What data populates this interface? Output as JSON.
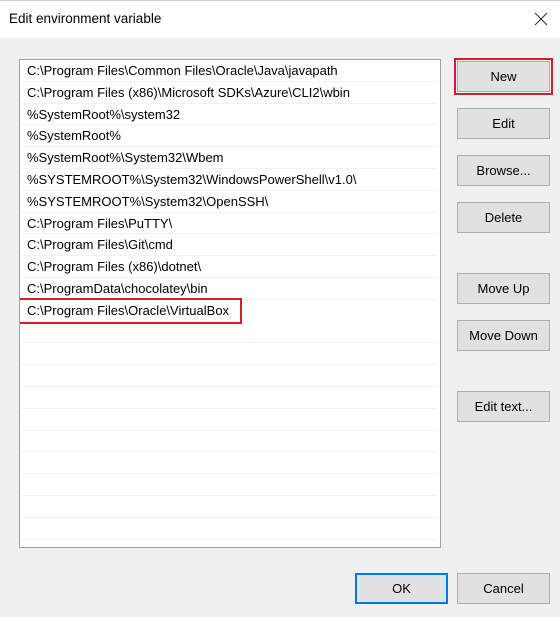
{
  "window": {
    "title": "Edit environment variable",
    "close_icon": "close-icon"
  },
  "path_list": {
    "items": [
      "C:\\Program Files\\Common Files\\Oracle\\Java\\javapath",
      "C:\\Program Files (x86)\\Microsoft SDKs\\Azure\\CLI2\\wbin",
      "%SystemRoot%\\system32",
      "%SystemRoot%",
      "%SystemRoot%\\System32\\Wbem",
      "%SYSTEMROOT%\\System32\\WindowsPowerShell\\v1.0\\",
      "%SYSTEMROOT%\\System32\\OpenSSH\\",
      "C:\\Program Files\\PuTTY\\",
      "C:\\Program Files\\Git\\cmd",
      "C:\\Program Files (x86)\\dotnet\\",
      "C:\\ProgramData\\chocolatey\\bin",
      "C:\\Program Files\\Oracle\\VirtualBox"
    ],
    "highlighted_index": 11,
    "empty_rows": 10
  },
  "buttons": {
    "new": "New",
    "edit": "Edit",
    "browse": "Browse...",
    "delete": "Delete",
    "move_up": "Move Up",
    "move_down": "Move Down",
    "edit_text": "Edit text...",
    "ok": "OK",
    "cancel": "Cancel"
  },
  "colors": {
    "annotation_red": "#d0202a",
    "default_button_border": "#0078d7"
  }
}
